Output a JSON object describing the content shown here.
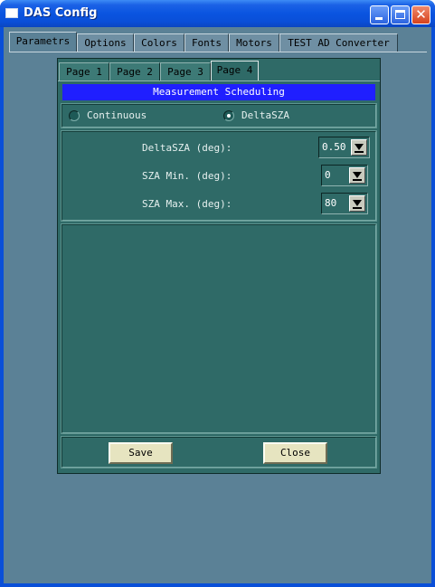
{
  "window": {
    "title": "DAS Config"
  },
  "outer_tabs": [
    "Parametrs",
    "Options",
    "Colors",
    "Fonts",
    "Motors",
    "TEST AD Converter"
  ],
  "inner_tabs": [
    "Page 1",
    "Page 2",
    "Page 3",
    "Page 4"
  ],
  "section_title": "Measurement Scheduling",
  "radio": {
    "continuous": "Continuous",
    "deltasza": "DeltaSZA",
    "selected": "DeltaSZA"
  },
  "fields": {
    "deltasza_label": "DeltaSZA (deg):",
    "deltasza_value": "0.50",
    "sza_min_label": "SZA Min. (deg):",
    "sza_min_value": "0",
    "sza_max_label": "SZA Max. (deg):",
    "sza_max_value": "80"
  },
  "buttons": {
    "save": "Save",
    "close": "Close"
  },
  "icons": [
    "app-window-icon",
    "minimize-icon",
    "maximize-icon",
    "close-icon",
    "dropdown-arrow-icon"
  ],
  "colors": {
    "titlebar": "#0a4fd8",
    "client": "#5b8196",
    "panel": "#2f6a67",
    "header_bar": "#1f1fff",
    "button": "#e6e4c0"
  }
}
